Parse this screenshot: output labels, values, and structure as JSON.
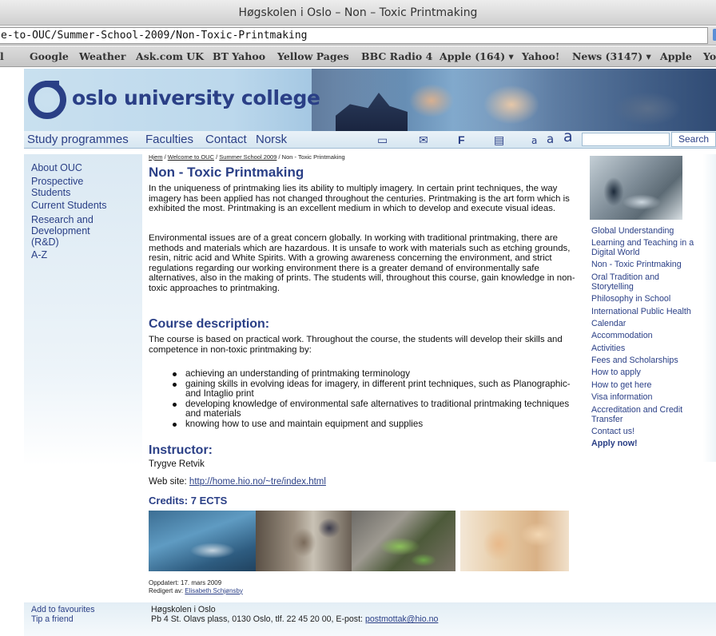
{
  "browser": {
    "window_title": "Høgskolen i Oslo – Non – Toxic Printmaking",
    "url": "e-to-OUC/Summer-School-2009/Non-Toxic-Printmaking",
    "bookmarks": [
      "l",
      "Google",
      "Weather",
      "Ask.com UK",
      "BT Yahoo",
      "Yellow Pages",
      "BBC Radio 4",
      "Apple (164) ▾",
      "Yahoo!",
      "News (3147) ▾",
      "Apple",
      "Yo"
    ]
  },
  "site": {
    "logo_text": "oslo university college",
    "colors": {
      "brand": "#2a3f86",
      "nav_bg": "#dbe9f3"
    }
  },
  "topnav": {
    "links": [
      "Study programmes",
      "Faculties",
      "Contact",
      "Norsk"
    ],
    "icons": [
      "print-icon",
      "mail-icon",
      "facebook-icon",
      "book-icon"
    ],
    "icon_glyphs": [
      "▭",
      "✉",
      "F",
      "▤"
    ],
    "font_sizes": [
      "a",
      "a",
      "a"
    ],
    "search_label": "Search"
  },
  "leftnav": {
    "items": [
      "About OUC",
      "Prospective Students",
      "Current Students",
      "Research and Development (R&D)",
      "A-Z"
    ]
  },
  "breadcrumb": {
    "items": [
      "Hjem",
      "Welcome to OUC",
      "Summer School 2009"
    ],
    "separator": " / ",
    "current": "Non - Toxic Printmaking"
  },
  "article": {
    "title": "Non - Toxic Printmaking",
    "para1": "In the uniqueness of printmaking lies its ability to multiply imagery. In certain print techniques, the way imagery has been applied has not changed throughout the centuries. Printmaking is the art form which is exhibited the most. Printmaking is an excellent medium in which to develop and execute visual ideas.",
    "para2": "Environmental issues are of a great concern globally. In working with traditional printmaking, there are methods and materials which are hazardous. It is unsafe to work with materials such as etching grounds, resin, nitric acid and White Spirits. With a growing awareness concerning the environment, and strict regulations regarding our working environment there is a greater demand of environmentally safe alternatives, also in the making of prints. The students will, throughout this course, gain knowledge in non-toxic approaches to printmaking.",
    "course_heading": "Course description:",
    "course_intro": "The course is based on practical work. Throughout the course, the students will develop their skills and competence in non-toxic printmaking by:",
    "bullets": [
      "achieving an understanding of printmaking terminology",
      "gaining skills in evolving ideas for imagery, in different print techniques, such as Planographic- and Intaglio print",
      "developing knowledge of environmental safe alternatives to traditional printmaking techniques and materials",
      "knowing how to use and maintain equipment and supplies"
    ],
    "instructor_heading": "Instructor:",
    "instructor_name": "Trygve Retvik",
    "website_label": "Web site: ",
    "website_url": "http://home.hio.no/~tre/index.html",
    "credits": "Credits: 7 ECTS",
    "updated_label": "Oppdatert: 17. mars 2009",
    "edited_label": "Redigert av: ",
    "edited_by": "Elisabeth Schjønsby"
  },
  "rightnav": {
    "items": [
      "Global Understanding",
      "Learning and Teaching in a Digital World",
      "Non - Toxic Printmaking",
      "Oral Tradition and Storytelling",
      "Philosophy in School",
      "International Public Health",
      "Calendar",
      "Accommodation",
      "Activities",
      "Fees and Scholarships",
      "How to apply",
      "How to get here",
      "Visa information",
      "Accreditation and Credit Transfer",
      "Contact us!",
      "Apply now!"
    ]
  },
  "footer": {
    "add_favourites": "Add to favourites",
    "tip_friend": "Tip a friend",
    "org": "Høgskolen i Oslo",
    "address": "Pb 4 St. Olavs plass, 0130 Oslo, tlf. 22 45 20 00, E-post: ",
    "email": "postmottak@hio.no"
  }
}
